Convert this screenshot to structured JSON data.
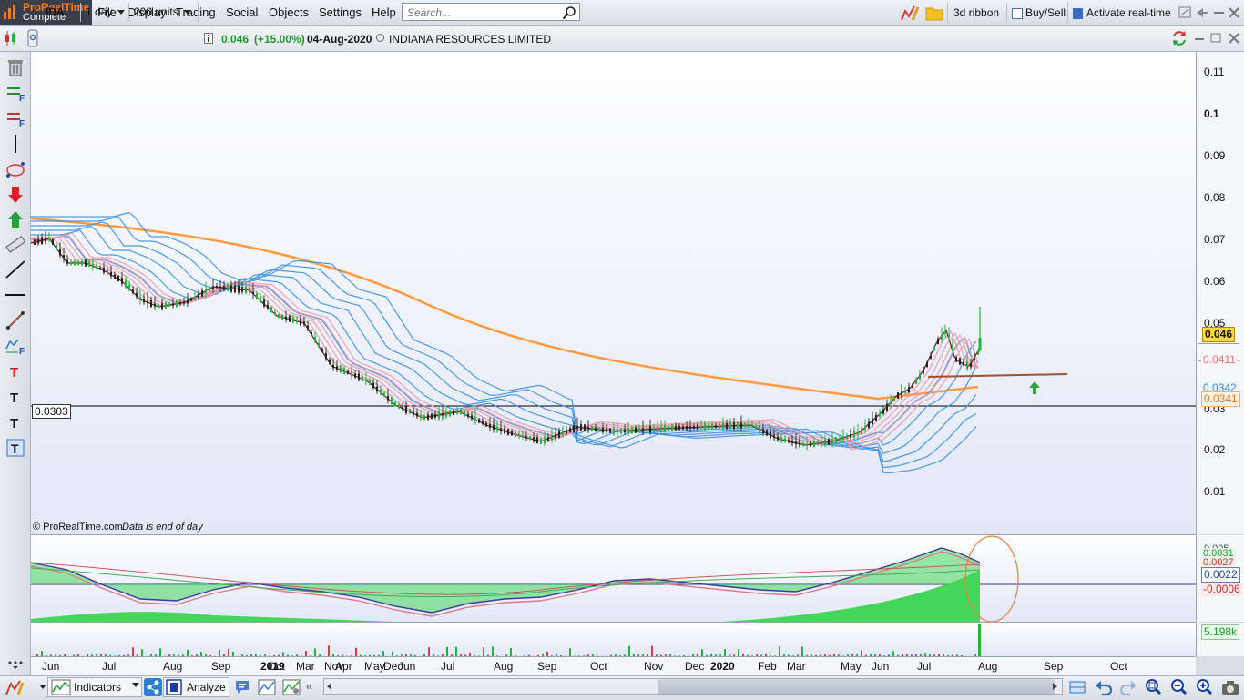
{
  "app": {
    "name": "ProRealTime",
    "edition": "Complete"
  },
  "menu": {
    "items": [
      "File",
      "Display",
      "Trading",
      "Social",
      "Objects",
      "Settings",
      "Help"
    ]
  },
  "search": {
    "placeholder": "Search..."
  },
  "toolbar_right": {
    "ribbon_label": "3d ribbon",
    "buysell_label": "Buy/Sell",
    "realtime_label": "Activate real-time"
  },
  "instrument": {
    "ticker": "IDA",
    "timeframe": "1 day",
    "units": "200 units",
    "price": "0.046",
    "change": "(+15.00%)",
    "date": "04-Aug-2020",
    "name": "INDIANA RESOURCES LIMITED"
  },
  "main_chart": {
    "watermark": "© ProRealTime.com",
    "note": "Data is end of day",
    "ticks": [
      "0.11",
      "0.1",
      "0.09",
      "0.08",
      "0.07",
      "0.06",
      "0.05",
      "0.03",
      "0.02",
      "0.01"
    ],
    "hline_label": "0.0303",
    "price_labels": {
      "last": "0.046",
      "ema_fast": "0.0411",
      "ema_slow": "0.0342",
      "ma200": "0.0341"
    }
  },
  "oscillator": {
    "labels": {
      "top": "0.0031",
      "mid": "0.0027",
      "value": "0.0022",
      "neg": "-0.0006"
    },
    "partial_tick": "0.005"
  },
  "volume": {
    "label": "5.198k"
  },
  "time_axis": {
    "labels": [
      "Jun",
      "Jul",
      "Aug",
      "Sep",
      "Oct",
      "Nov",
      "Dec",
      "2019",
      "Mar",
      "Apr",
      "May",
      "Jun",
      "Jul",
      "Aug",
      "Sep",
      "Oct",
      "Nov",
      "Dec",
      "2020",
      "Feb",
      "Mar",
      "May",
      "Jun",
      "Jul",
      "Aug",
      "Sep",
      "Oct"
    ]
  },
  "bottom": {
    "indicators_label": "Indicators",
    "analyze_label": "Analyze"
  },
  "colors": {
    "up_candle": "#22b33a",
    "down_candle": "#c0392b",
    "ma200": "#ff9a3c",
    "ribbon_fast": "#e89aa8",
    "ribbon_slow": "#3a8ee6",
    "trendline": "#a0522d",
    "hline": "#000000",
    "osc_fill": "#43d65a",
    "osc_neg": "#e07a8a",
    "volume": "#22b33a",
    "price_highlight": "#ffd83a",
    "circle": "#f07a3a"
  }
}
